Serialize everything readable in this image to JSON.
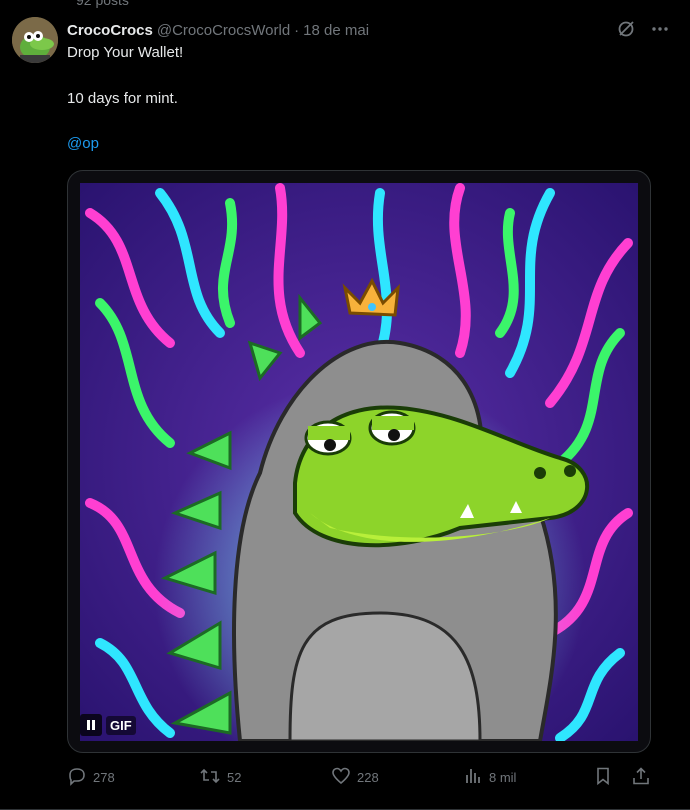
{
  "profile": {
    "posts_count": "92 posts"
  },
  "tweet": {
    "display_name": "CrocoCrocs",
    "handle": "@CrocoCrocsWorld",
    "separator": "·",
    "date": "18 de mai",
    "line1": "Drop Your Wallet!",
    "line2": "10 days for mint.",
    "mention": "@op"
  },
  "media": {
    "badge": "GIF",
    "icons": [
      "pause-icon"
    ]
  },
  "actions": {
    "replies": "278",
    "reposts": "52",
    "likes": "228",
    "views": "8 mil"
  },
  "icons": [
    "grok-icon",
    "more-icon",
    "reply-icon",
    "repost-icon",
    "like-icon",
    "views-icon",
    "bookmark-icon",
    "share-icon"
  ],
  "colors": {
    "accent": "#1d9bf0",
    "muted": "#71767b",
    "text": "#e7e9ea",
    "background": "#000000"
  }
}
